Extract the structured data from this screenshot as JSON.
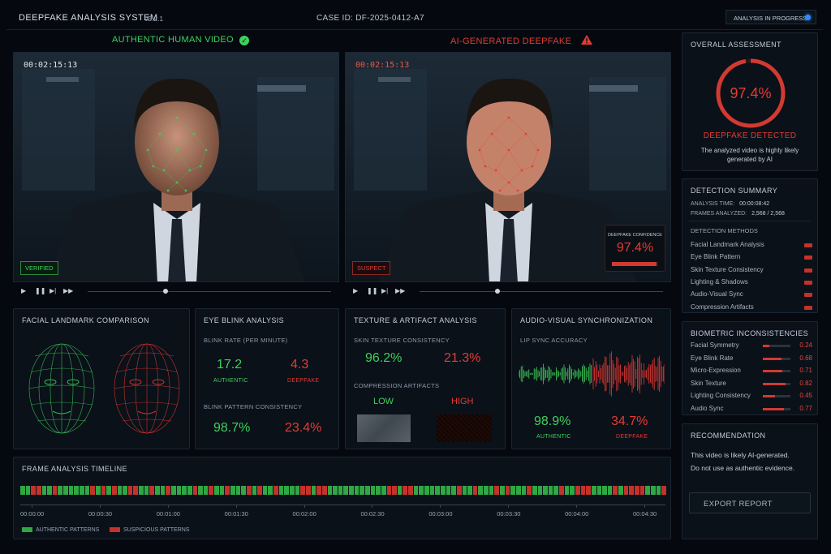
{
  "header": {
    "app_title": "DEEPFAKE ANALYSIS SYSTEM",
    "version": "v5.2.1",
    "case_id": "CASE ID: DF-2025-0412-A7",
    "status": "ANALYSIS IN PROGRESS"
  },
  "videos": {
    "left": {
      "heading": "AUTHENTIC HUMAN VIDEO",
      "timestamp": "00:02:15:13",
      "tag": "VERIFIED",
      "progress": 0.31
    },
    "right": {
      "heading": "AI-GENERATED DEEPFAKE",
      "timestamp": "00:02:15:13",
      "tag": "SUSPECT",
      "confidence_label": "DEEPFAKE CONFIDENCE",
      "confidence_value": "97.4%",
      "progress": 0.31
    }
  },
  "facial_landmark": {
    "title": "FACIAL LANDMARK COMPARISON"
  },
  "eye_blink": {
    "title": "EYE BLINK ANALYSIS",
    "rate_label": "BLINK RATE (PER MINUTE)",
    "rate_authentic": "17.2",
    "rate_deepfake": "4.3",
    "authentic_label": "AUTHENTIC",
    "deepfake_label": "DEEPFAKE",
    "pattern_label": "BLINK PATTERN CONSISTENCY",
    "pattern_authentic": "98.7%",
    "pattern_deepfake": "23.4%"
  },
  "texture": {
    "title": "TEXTURE & ARTIFACT ANALYSIS",
    "skin_label": "SKIN TEXTURE CONSISTENCY",
    "skin_authentic": "96.2%",
    "skin_deepfake": "21.3%",
    "compression_label": "COMPRESSION ARTIFACTS",
    "low_label": "LOW",
    "high_label": "HIGH"
  },
  "audio_visual": {
    "title": "AUDIO-VISUAL SYNCHRONIZATION",
    "lip_label": "LIP SYNC ACCURACY",
    "authentic_value": "98.9%",
    "deepfake_value": "34.7%",
    "authentic_label": "AUTHENTIC",
    "deepfake_label": "DEEPFAKE"
  },
  "timeline": {
    "title": "FRAME ANALYSIS TIMELINE",
    "ticks": [
      "00:00:00",
      "00:00:30",
      "00:01:00",
      "00:01:30",
      "00:02:00",
      "00:02:30",
      "00:03:00",
      "00:03:30",
      "00:04:00",
      "00:04:30"
    ],
    "legend_authentic": "AUTHENTIC PATTERNS",
    "legend_suspicious": "SUSPICIOUS PATTERNS"
  },
  "overall": {
    "title": "OVERALL ASSESSMENT",
    "score": "97.4%",
    "score_fraction": 0.974,
    "verdict": "DEEPFAKE DETECTED",
    "description": "The analyzed video is highly likely generated by AI"
  },
  "detection_summary": {
    "title": "DETECTION SUMMARY",
    "analysis_time_label": "ANALYSIS TIME:",
    "analysis_time": "00:00:08:42",
    "frames_label": "FRAMES ANALYZED:",
    "frames": "2,568 / 2,568",
    "methods_title": "DETECTION METHODS",
    "methods": [
      "Facial Landmark Analysis",
      "Eye Blink Pattern",
      "Skin Texture Consistency",
      "Lighting & Shadows",
      "Audio-Visual Sync",
      "Compression Artifacts"
    ]
  },
  "biometric": {
    "title": "BIOMETRIC INCONSISTENCIES",
    "items": [
      {
        "label": "Facial Symmetry",
        "value": "0.24",
        "level": 0.24
      },
      {
        "label": "Eye Blink Rate",
        "value": "0.68",
        "level": 0.68
      },
      {
        "label": "Micro-Expression",
        "value": "0.71",
        "level": 0.71
      },
      {
        "label": "Skin Texture",
        "value": "0.82",
        "level": 0.82
      },
      {
        "label": "Lighting Consistency",
        "value": "0.45",
        "level": 0.45
      },
      {
        "label": "Audio Sync",
        "value": "0.77",
        "level": 0.77
      }
    ]
  },
  "recommendation": {
    "title": "RECOMMENDATION",
    "line1": "This video is likely AI-generated.",
    "line2": "Do not use as authentic evidence.",
    "export_label": "EXPORT REPORT"
  },
  "colors": {
    "authentic": "#3ed15a",
    "deepfake": "#e53a33",
    "accent_blue": "#2e8cff"
  }
}
